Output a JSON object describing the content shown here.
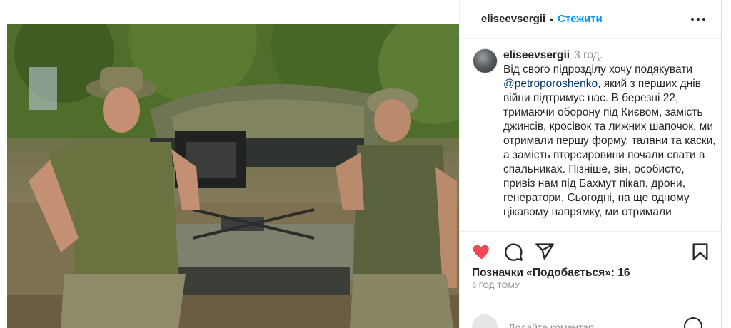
{
  "post": {
    "username": "eliseevsergii",
    "separator": "•",
    "follow_label": "Стежити",
    "more_icon": "more-horizontal-icon"
  },
  "comment": {
    "username": "eliseevsergii",
    "time": "3 год.",
    "text_before_mention": "Від свого підрозділу хочу подякувати ",
    "mention": "@petroporoshenko",
    "text_after_mention": ", який з перших днів війни підтримує нас. В березні 22, тримаючи оборону під Києвом, замість джинсів, кросівок та лижних шапочок, ми отримали першу форму, талани та каски, а замість вторсировини почали спати в спальниках. Пізніше, він, особисто, привіз нам під Бахмут пікап, дрони, генератори. Сьогодні, на ще одному цікавому напрямку, ми отримали"
  },
  "actions": {
    "like_icon": "heart-icon",
    "comment_icon": "comment-icon",
    "share_icon": "share-icon",
    "save_icon": "bookmark-icon",
    "like_color": "#ed4956"
  },
  "likes_text": "Позначки «Подобається»: 16",
  "post_time": "3 ГОД ТОМУ",
  "add_comment": {
    "placeholder": "Додайте коментар..."
  }
}
